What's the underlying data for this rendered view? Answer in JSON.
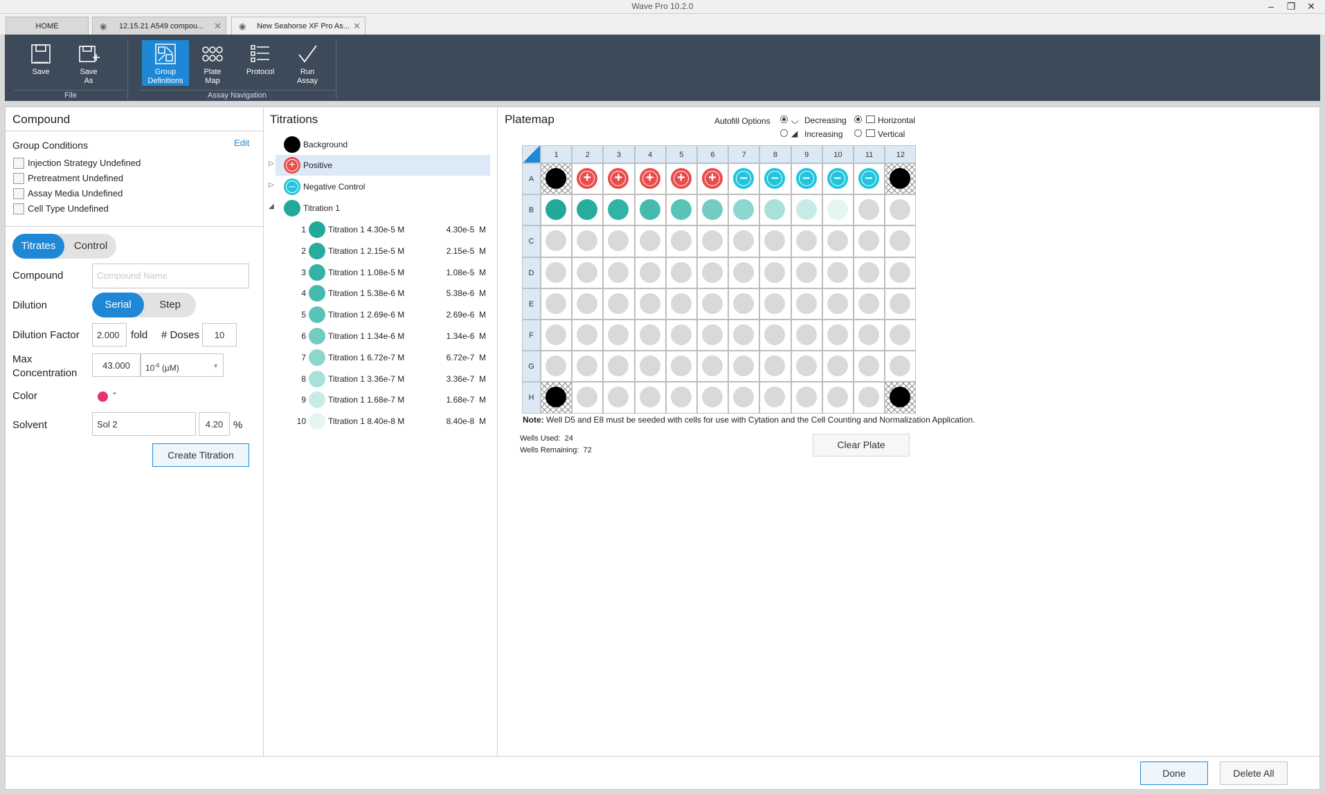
{
  "window": {
    "title": "Wave Pro 10.2.0"
  },
  "tabs": [
    {
      "label": "HOME"
    },
    {
      "label": "12.15.21 A549 compou..."
    },
    {
      "label": "New Seahorse XF Pro As..."
    }
  ],
  "ribbon": {
    "file_group": "File",
    "nav_group": "Assay Navigation",
    "buttons": {
      "save": "Save",
      "save_as_1": "Save",
      "save_as_2": "As",
      "group_def_1": "Group",
      "group_def_2": "Definitions",
      "plate_map_1": "Plate",
      "plate_map_2": "Map",
      "protocol": "Protocol",
      "run_assay_1": "Run",
      "run_assay_2": "Assay"
    }
  },
  "compound": {
    "title": "Compound",
    "group_conditions": "Group Conditions",
    "edit": "Edit",
    "conditions": [
      "Injection Strategy Undefined",
      "Pretreatment Undefined",
      "Assay Media Undefined",
      "Cell Type Undefined"
    ],
    "toggle_titrates": "Titrates",
    "toggle_control": "Control",
    "compound_label": "Compound",
    "compound_placeholder": "Compound Name",
    "dilution_label": "Dilution",
    "dilution_serial": "Serial",
    "dilution_step": "Step",
    "dilution_factor_label": "Dilution Factor",
    "dilution_factor_value": "2.000",
    "fold": "fold",
    "doses_label": "# Doses",
    "doses_value": "10",
    "max_conc_label_1": "Max",
    "max_conc_label_2": "Concentration",
    "max_conc_value": "43.000",
    "unit_base": "10",
    "unit_exp": "-6",
    "unit_rest": " (µM)",
    "color_label": "Color",
    "color_value": "#e8336a",
    "solvent_label": "Solvent",
    "solvent_value": "Sol 2",
    "solvent_pct": "4.20",
    "pct": "%",
    "create_button": "Create Titration"
  },
  "titrations": {
    "title": "Titrations",
    "groups": [
      {
        "name": "Background",
        "color": "#000000"
      },
      {
        "name": "Positive",
        "color": "#e84c4c"
      },
      {
        "name": "Negative Control",
        "color": "#20c4dd"
      },
      {
        "name": "Titration 1",
        "color": "#22a99a"
      }
    ],
    "items": [
      {
        "idx": "1",
        "name": "Titration 1 4.30e-5 M",
        "conc": "4.30e-5  M",
        "color": "#22a99a"
      },
      {
        "idx": "2",
        "name": "Titration 1 2.15e-5 M",
        "conc": "2.15e-5  M",
        "color": "#27ad9e"
      },
      {
        "idx": "3",
        "name": "Titration 1 1.08e-5 M",
        "conc": "1.08e-5  M",
        "color": "#32b3a5"
      },
      {
        "idx": "4",
        "name": "Titration 1 5.38e-6 M",
        "conc": "5.38e-6  M",
        "color": "#45bbae"
      },
      {
        "idx": "5",
        "name": "Titration 1 2.69e-6 M",
        "conc": "2.69e-6  M",
        "color": "#5ac3b7"
      },
      {
        "idx": "6",
        "name": "Titration 1 1.34e-6 M",
        "conc": "1.34e-6  M",
        "color": "#72ccc2"
      },
      {
        "idx": "7",
        "name": "Titration 1 6.72e-7 M",
        "conc": "6.72e-7  M",
        "color": "#8dd7ce"
      },
      {
        "idx": "8",
        "name": "Titration 1 3.36e-7 M",
        "conc": "3.36e-7  M",
        "color": "#a9e1da"
      },
      {
        "idx": "9",
        "name": "Titration 1 1.68e-7 M",
        "conc": "1.68e-7  M",
        "color": "#c7ece7"
      },
      {
        "idx": "10",
        "name": "Titration 1 8.40e-8 M",
        "conc": "8.40e-8  M",
        "color": "#e4f5f2"
      }
    ]
  },
  "platemap": {
    "title": "Platemap",
    "autofill_label": "Autofill Options",
    "decreasing": "Decreasing",
    "increasing": "Increasing",
    "horizontal": "Horizontal",
    "vertical": "Vertical",
    "columns": [
      "1",
      "2",
      "3",
      "4",
      "5",
      "6",
      "7",
      "8",
      "9",
      "10",
      "11",
      "12"
    ],
    "rows": [
      "A",
      "B",
      "C",
      "D",
      "E",
      "F",
      "G",
      "H"
    ],
    "note_bold": "Note:",
    "note_text": " Well D5 and E8 must be seeded with cells for use with Cytation and the Cell Counting and Normalization Application.",
    "wells_used_label": "Wells Used:",
    "wells_used": "24",
    "wells_remaining_label": "Wells Remaining:",
    "wells_remaining": "72",
    "clear_button": "Clear Plate",
    "row_A": [
      "bg",
      "pos",
      "pos",
      "pos",
      "pos",
      "pos",
      "neg",
      "neg",
      "neg",
      "neg",
      "neg",
      "bg"
    ],
    "row_B": [
      "#22a99a",
      "#27ad9e",
      "#32b3a5",
      "#45bbae",
      "#5ac3b7",
      "#72ccc2",
      "#8dd7ce",
      "#a9e1da",
      "#c7ece7",
      "#e4f5f2",
      "empty",
      "empty"
    ],
    "row_H": [
      "bg",
      "empty",
      "empty",
      "empty",
      "empty",
      "empty",
      "empty",
      "empty",
      "empty",
      "empty",
      "empty",
      "bg"
    ],
    "empty_color": "#d9d9d9"
  },
  "footer": {
    "done": "Done",
    "delete_all": "Delete All"
  }
}
